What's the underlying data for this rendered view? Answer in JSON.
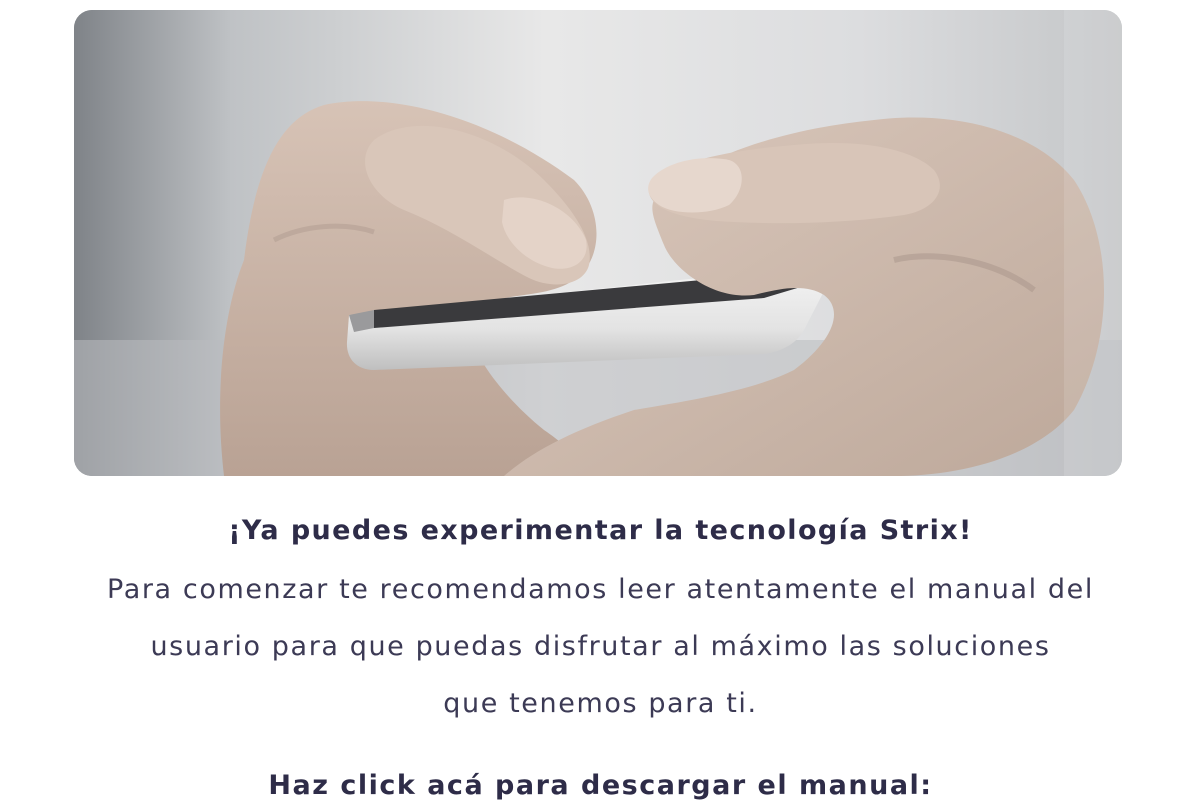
{
  "hero": {
    "image_description_icon": "hands-holding-smartphone-photo"
  },
  "content": {
    "headline": "¡Ya puedes experimentar la tecnología Strix!",
    "body_lines": [
      "Para comenzar te recomendamos leer atentamente el manual del",
      "usuario para que puedas disfrutar al máximo las soluciones",
      "que tenemos para ti."
    ],
    "cta": "Haz click acá para descargar el manual:"
  },
  "colors": {
    "text_dark": "#2e2c48",
    "text_body": "#3c3a55",
    "background": "#ffffff"
  }
}
